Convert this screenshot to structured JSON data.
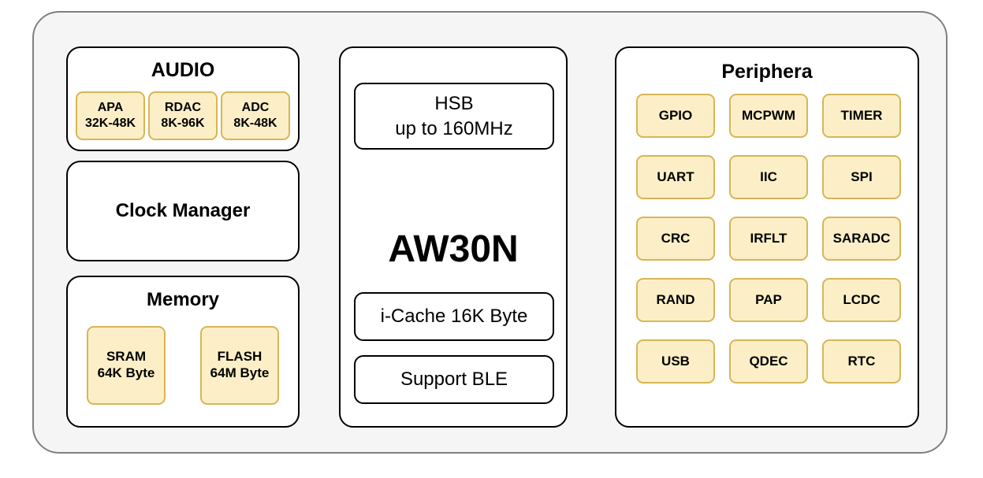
{
  "diagram": {
    "title": "AW30N SoC block diagram",
    "colors": {
      "chip_background": "#f5f5f5",
      "chip_border": "#808080",
      "group_background": "#ffffff",
      "group_border": "#000000",
      "block_fill": "#fcefc7",
      "block_border": "#d6b656",
      "text": "#000000"
    }
  },
  "left_column": {
    "audio": {
      "title": "AUDIO",
      "blocks": [
        {
          "name": "APA",
          "spec": "32K-48K"
        },
        {
          "name": "RDAC",
          "spec": "8K-96K"
        },
        {
          "name": "ADC",
          "spec": "8K-48K"
        }
      ]
    },
    "clock_manager": {
      "title": "Clock Manager"
    },
    "memory": {
      "title": "Memory",
      "blocks": [
        {
          "name": "SRAM",
          "spec": "64K Byte"
        },
        {
          "name": "FLASH",
          "spec": "64M Byte"
        }
      ]
    }
  },
  "center_column": {
    "core_name": "AW30N",
    "hsb": {
      "line1": "HSB",
      "line2": "up to 160MHz"
    },
    "icache": "i-Cache 16K Byte",
    "ble": "Support BLE"
  },
  "right_column": {
    "title": "Periphera",
    "blocks": [
      "GPIO",
      "MCPWM",
      "TIMER",
      "UART",
      "IIC",
      "SPI",
      "CRC",
      "IRFLT",
      "SARADC",
      "RAND",
      "PAP",
      "LCDC",
      "USB",
      "QDEC",
      "RTC"
    ]
  }
}
